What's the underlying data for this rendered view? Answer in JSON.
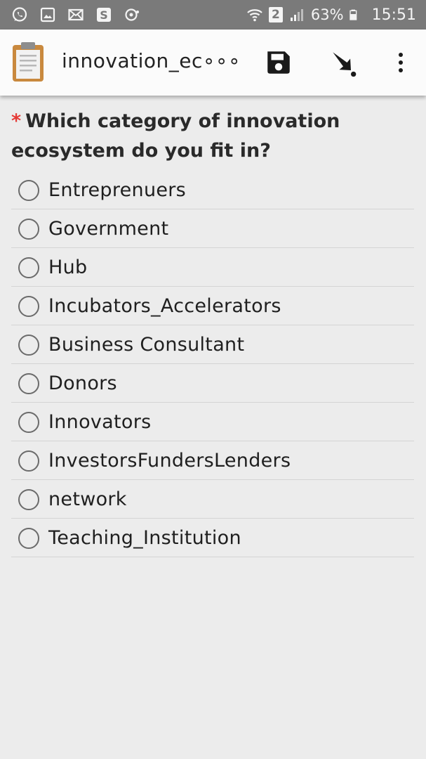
{
  "status_bar": {
    "icons_left": [
      "whatsapp-icon",
      "gallery-icon",
      "mail-icon",
      "skype-icon",
      "sync-icon"
    ],
    "icons_right": [
      "wifi-icon",
      "sim2-icon",
      "signal-icon",
      "battery-icon"
    ],
    "sim_label": "2",
    "battery_percent": "63%",
    "battery_level": 0.63,
    "time": "15:51"
  },
  "app_bar": {
    "logo_icon": "clipboard-icon",
    "title": "innovation_ec∘∘∘",
    "actions": [
      "save-icon",
      "send-finalize-icon",
      "more-vert-icon"
    ]
  },
  "question": {
    "required_marker": "*",
    "text": "Which category of innovation ecosystem do you fit in?"
  },
  "options": [
    {
      "label": "Entreprenuers",
      "selected": false
    },
    {
      "label": "Government",
      "selected": false
    },
    {
      "label": "Hub",
      "selected": false
    },
    {
      "label": "Incubators_Accelerators",
      "selected": false
    },
    {
      "label": "Business Consultant",
      "selected": false
    },
    {
      "label": "Donors",
      "selected": false
    },
    {
      "label": "Innovators",
      "selected": false
    },
    {
      "label": "InvestorsFundersLenders",
      "selected": false
    },
    {
      "label": "network",
      "selected": false
    },
    {
      "label": "Teaching_Institution",
      "selected": false
    }
  ],
  "colors": {
    "status_bar": "#7a7a7a",
    "app_bar": "#fbfbfb",
    "background": "#ececec",
    "required": "#e53935"
  }
}
